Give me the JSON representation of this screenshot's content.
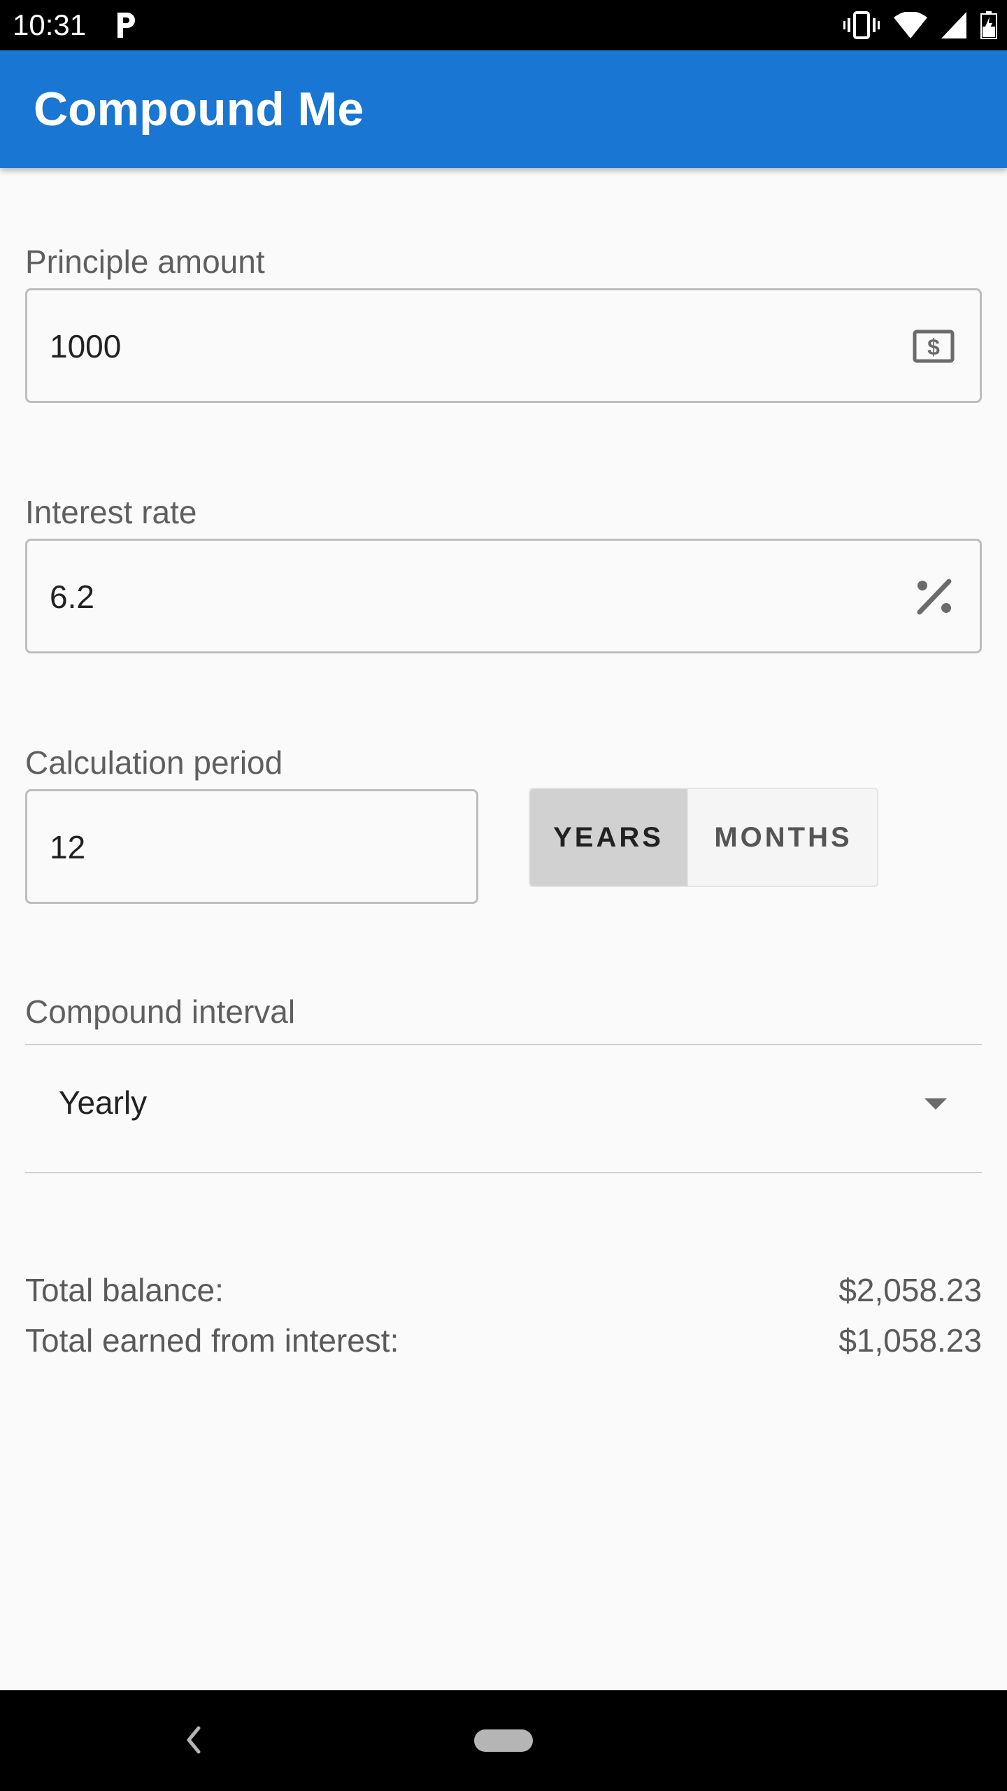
{
  "status_bar": {
    "time": "10:31",
    "icons": [
      "parking-icon",
      "vibrate-icon",
      "wifi-icon",
      "signal-icon",
      "battery-icon"
    ]
  },
  "app_bar": {
    "title": "Compound Me",
    "color": "#1976d2"
  },
  "form": {
    "principal": {
      "label": "Principle amount",
      "value": "1000",
      "suffix_icon": "money-icon"
    },
    "interest_rate": {
      "label": "Interest rate",
      "value": "6.2",
      "suffix_icon": "percent-icon"
    },
    "period": {
      "label": "Calculation period",
      "value": "12",
      "units": [
        "YEARS",
        "MONTHS"
      ],
      "selected_unit": "YEARS"
    },
    "compound_interval": {
      "label": "Compound interval",
      "selected": "Yearly"
    }
  },
  "summary": {
    "total_balance_label": "Total balance:",
    "total_balance_value": "$2,058.23",
    "interest_label": "Total earned from interest:",
    "interest_value": "$1,058.23"
  }
}
